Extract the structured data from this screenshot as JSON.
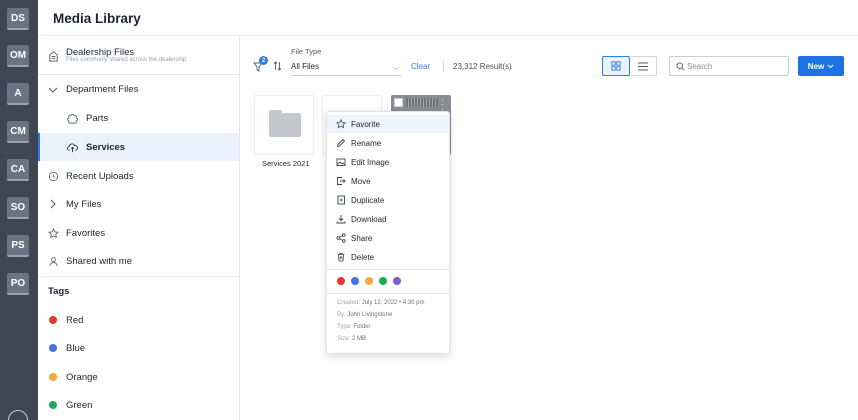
{
  "app": {
    "title": "Media Library"
  },
  "rail": {
    "items": [
      "DS",
      "OM",
      "A",
      "CM",
      "CA",
      "SO",
      "PS",
      "PO"
    ]
  },
  "sidebar": {
    "dealership": {
      "label": "Dealership Files",
      "subtitle": "Files commonly shared across the dealership"
    },
    "department": {
      "label": "Department Files",
      "children": [
        "Parts",
        "Services"
      ],
      "active": "Services"
    },
    "items": [
      "Recent Uploads",
      "My Files",
      "Favorites",
      "Shared with me"
    ],
    "tags_title": "Tags",
    "tags": [
      {
        "label": "Red",
        "color": "#e53a2f"
      },
      {
        "label": "Blue",
        "color": "#4a6fe6"
      },
      {
        "label": "Orange",
        "color": "#f6a93b"
      },
      {
        "label": "Green",
        "color": "#20a85a"
      }
    ]
  },
  "toolbar": {
    "filter_badge": "2",
    "file_type_label": "File Type",
    "file_type_value": "All Files",
    "clear": "Clear",
    "result_count": "23,312 Result(s)",
    "search_placeholder": "Search",
    "new_label": "New",
    "view_mode": "grid"
  },
  "files": [
    {
      "label": "Services 2021",
      "kind": "folder"
    },
    {
      "label": "",
      "kind": "folder"
    },
    {
      "label": "",
      "kind": "image"
    }
  ],
  "context_menu": {
    "items": [
      {
        "label": "Favorite",
        "icon": "star-icon"
      },
      {
        "label": "Rename",
        "icon": "pencil-icon"
      },
      {
        "label": "Edit Image",
        "icon": "image-edit-icon"
      },
      {
        "label": "Move",
        "icon": "move-icon"
      },
      {
        "label": "Duplicate",
        "icon": "duplicate-icon"
      },
      {
        "label": "Download",
        "icon": "download-icon"
      },
      {
        "label": "Share",
        "icon": "share-icon"
      },
      {
        "label": "Delete",
        "icon": "trash-icon"
      }
    ],
    "colors": [
      "#e53a2f",
      "#4a6fe6",
      "#f6a93b",
      "#20a85a",
      "#7a5cc7"
    ],
    "meta": {
      "created_key": "Created:",
      "created": "July 12, 2022 • 4:30 pm",
      "by_key": "By:",
      "by": "John Livingstone",
      "type_key": "Type:",
      "type": "Folder",
      "size_key": "Size:",
      "size": "2 MB"
    }
  }
}
